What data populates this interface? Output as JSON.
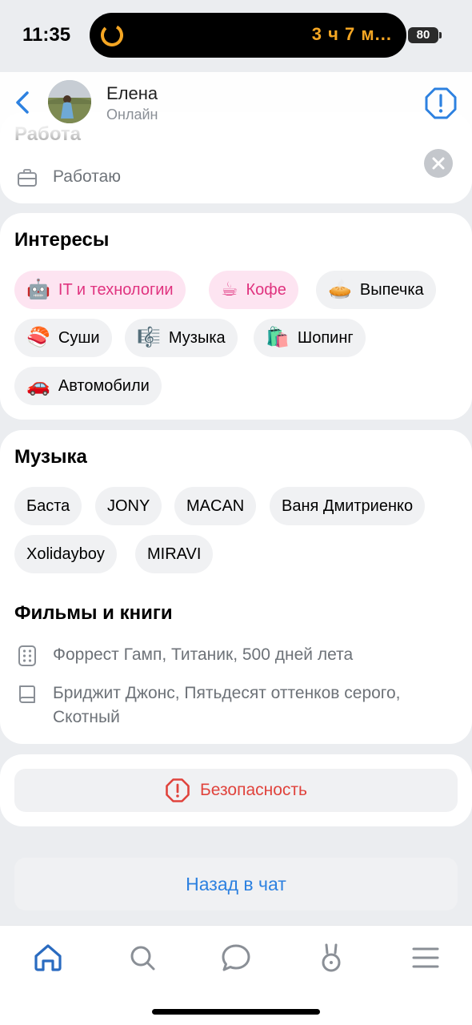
{
  "status_bar": {
    "time": "11:35",
    "island_text": "3 ч 7 м...",
    "battery": "80"
  },
  "header": {
    "name": "Елена",
    "status": "Онлайн"
  },
  "work": {
    "title": "Работа",
    "value": "Работаю"
  },
  "interests": {
    "title": "Интересы",
    "chips": [
      {
        "emoji": "🤖",
        "label": "IT и технологии",
        "highlighted": true
      },
      {
        "emoji": "☕",
        "label": "Кофе",
        "highlighted": true
      },
      {
        "emoji": "🥧",
        "label": "Выпечка",
        "highlighted": false
      },
      {
        "emoji": "🍣",
        "label": "Суши",
        "highlighted": false
      },
      {
        "emoji": "🎼",
        "label": "Музыка",
        "highlighted": false
      },
      {
        "emoji": "🛍️",
        "label": "Шопинг",
        "highlighted": false
      },
      {
        "emoji": "🚗",
        "label": "Автомобили",
        "highlighted": false
      }
    ]
  },
  "music": {
    "title": "Музыка",
    "chips": [
      "Баста",
      "JONY",
      "MACAN",
      "Ваня Дмитриенко",
      "Xolidayboy",
      "MIRAVI"
    ]
  },
  "films_books": {
    "title": "Фильмы и книги",
    "films": "Форрест Гамп, Титаник, 500 дней лета",
    "books_line1": "Бриджит Джонс, Пятьдесят оттенков серого,",
    "books_line2": "Скотный"
  },
  "safety": {
    "label": "Безопасность"
  },
  "back_to_chat": {
    "label": "Назад в чат"
  },
  "nav": {
    "items": [
      "home-icon",
      "search-icon",
      "messages-icon",
      "clips-icon",
      "menu-icon"
    ]
  },
  "colors": {
    "accent": "#2d81e0",
    "danger": "#e0433c",
    "pink_chip_bg": "#fde4f1",
    "pink_chip_text": "#e0337f"
  }
}
